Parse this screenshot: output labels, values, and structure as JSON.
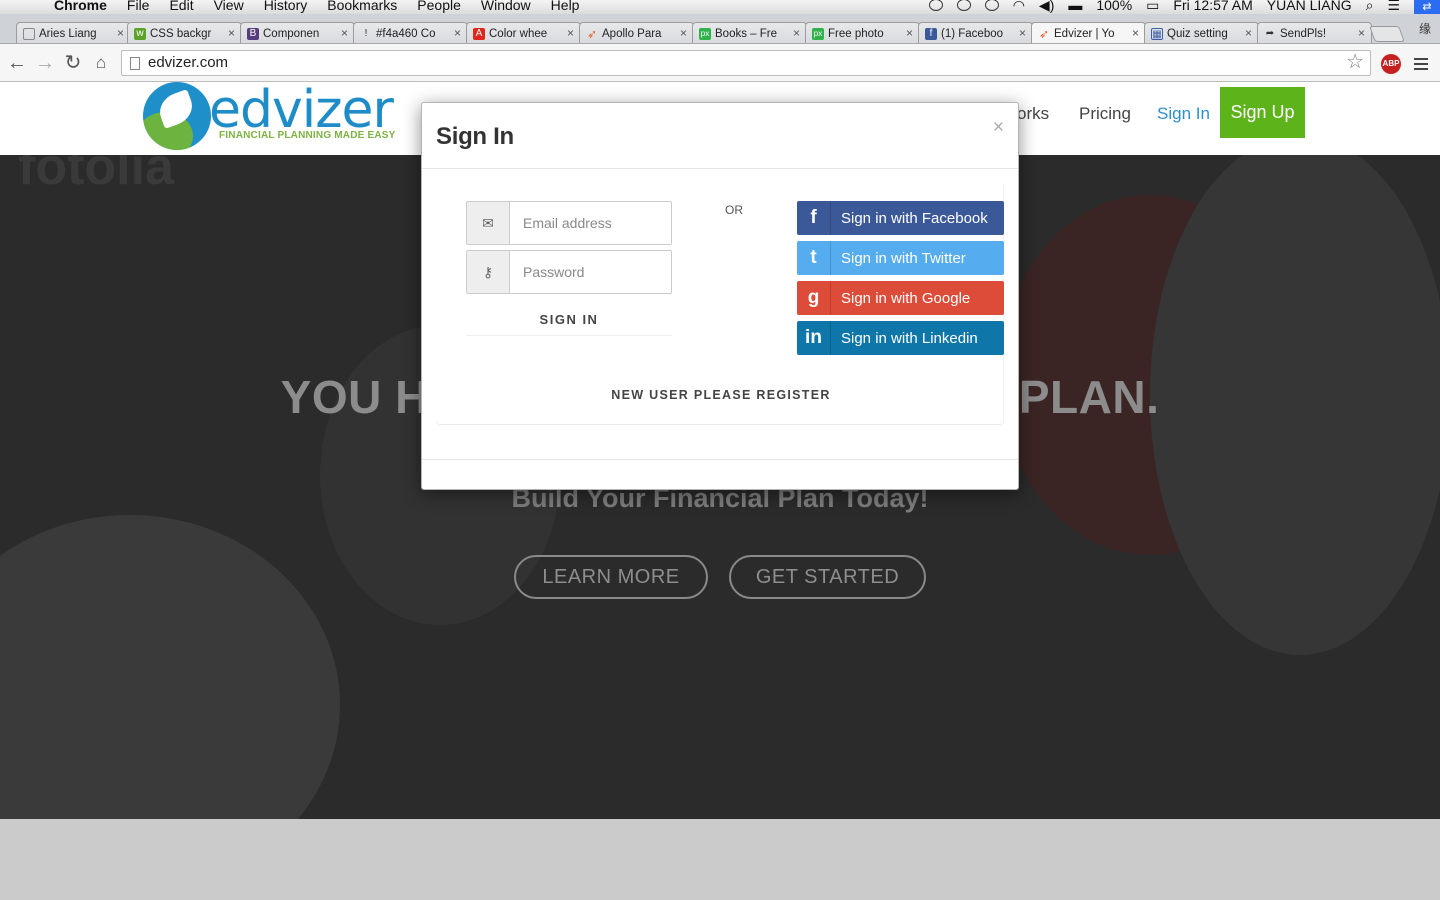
{
  "menubar": {
    "app": "Chrome",
    "items": [
      "File",
      "Edit",
      "View",
      "History",
      "Bookmarks",
      "People",
      "Window",
      "Help"
    ],
    "battery": "100%",
    "clock": "Fri 12:57 AM",
    "user": "YUAN LIANG"
  },
  "tabs": [
    {
      "title": "Aries Liang",
      "favicon": "page-icon",
      "color": "#ffffff"
    },
    {
      "title": "CSS backgr",
      "favicon": "w3-icon",
      "color": "#5aa32b"
    },
    {
      "title": "Componen",
      "favicon": "bootstrap-icon",
      "color": "#563d7c"
    },
    {
      "title": "#f4a460 Co",
      "favicon": "color-icon",
      "color": "#f4a460"
    },
    {
      "title": "Color whee",
      "favicon": "adobe-icon",
      "color": "#e0251b"
    },
    {
      "title": "Apollo Para",
      "favicon": "rocket-icon",
      "color": "#f05a28"
    },
    {
      "title": "Books – Fre",
      "favicon": "px-icon",
      "color": "#2fb34a"
    },
    {
      "title": "Free photo",
      "favicon": "px-icon",
      "color": "#2fb34a"
    },
    {
      "title": "(1) Faceboo",
      "favicon": "facebook-icon",
      "color": "#3b5998"
    },
    {
      "title": "Edvizer | Yo",
      "favicon": "rocket-icon",
      "color": "#f05a28",
      "active": true
    },
    {
      "title": "Quiz setting",
      "favicon": "grid-icon",
      "color": "#3b5ea8"
    },
    {
      "title": "SendPls!",
      "favicon": "share-icon",
      "color": "#333333"
    }
  ],
  "cjk_label": "缘",
  "omnibox": {
    "url": "edvizer.com"
  },
  "abp_label": "ABP",
  "site": {
    "logo_word": "edvizer",
    "logo_tagline": "FINANCIAL PLANNING MADE EASY",
    "nav": {
      "how_it_works": "orks",
      "pricing": "Pricing",
      "sign_in": "Sign In",
      "sign_up": "Sign Up"
    },
    "hero": {
      "watermark": "fotolia",
      "title_left": "YOU H",
      "title_right": "PLAN.",
      "subtitle": "Build Your Financial Plan Today!",
      "learn_more": "LEARN MORE",
      "get_started": "GET STARTED"
    }
  },
  "modal": {
    "title": "Sign In",
    "close": "×",
    "email_placeholder": "Email address",
    "password_placeholder": "Password",
    "sign_in_button": "SIGN IN",
    "or": "OR",
    "social": {
      "facebook": "Sign in with Facebook",
      "twitter": "Sign in with Twitter",
      "google": "Sign in with Google",
      "linkedin": "Sign in with Linkedin"
    },
    "register": "NEW USER PLEASE REGISTER"
  },
  "colors": {
    "brand_blue": "#1d8cc7",
    "brand_green": "#5cb31a",
    "facebook": "#3b5998",
    "twitter": "#55acee",
    "google": "#dd4b39",
    "linkedin": "#0e76a8"
  }
}
